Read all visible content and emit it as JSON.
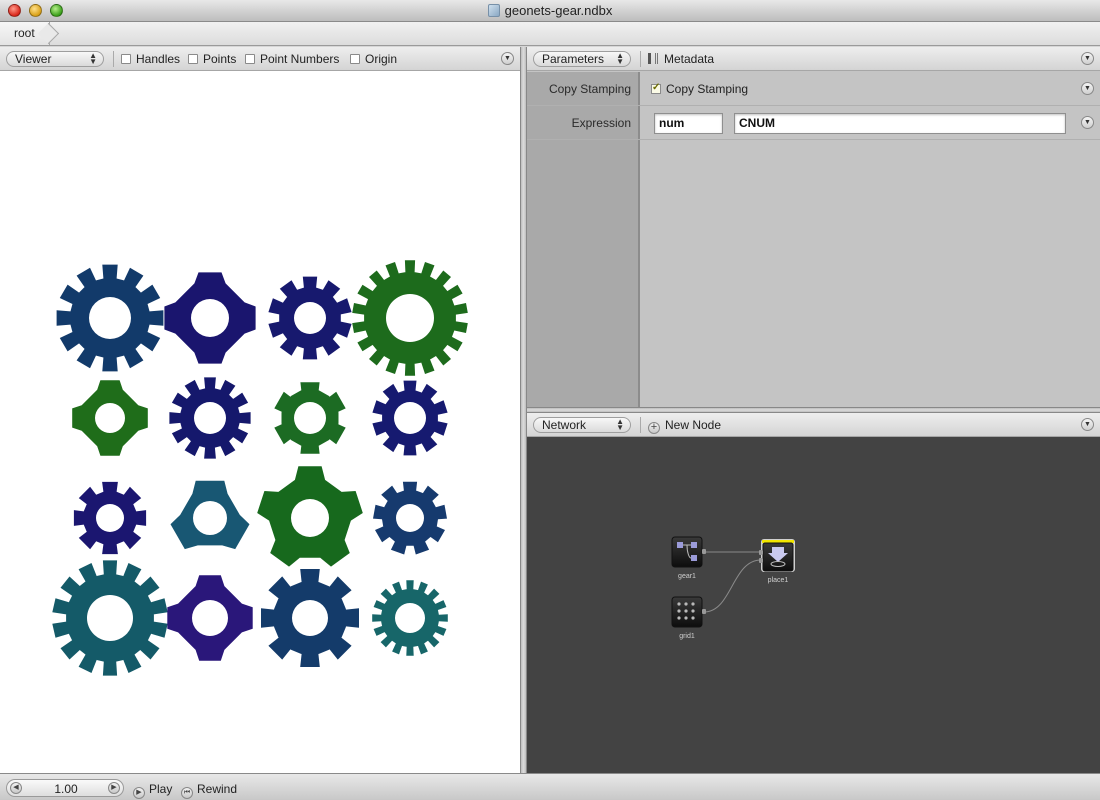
{
  "window": {
    "title": "geonets-gear.ndbx"
  },
  "path": {
    "root_label": "root"
  },
  "viewer": {
    "mode_label": "Viewer",
    "options": [
      {
        "label": "Handles"
      },
      {
        "label": "Points"
      },
      {
        "label": "Point Numbers"
      },
      {
        "label": "Origin"
      }
    ]
  },
  "parameters": {
    "tab_label": "Parameters",
    "metadata_label": "Metadata",
    "node_label": "Copy Stamping",
    "node_checkbox_label": "Copy Stamping",
    "expression_label": "Expression",
    "expression_name": "num",
    "expression_value": "CNUM"
  },
  "network": {
    "tab_label": "Network",
    "new_node_label": "New Node",
    "nodes": [
      {
        "name": "gear1"
      },
      {
        "name": "grid1"
      },
      {
        "name": "place1"
      }
    ]
  },
  "playback": {
    "frame": "1.00",
    "play_label": "Play",
    "rewind_label": "Rewind"
  },
  "gears": [
    {
      "teeth": 12,
      "color": "#123a6a"
    },
    {
      "teeth": 4,
      "color": "#1a156e"
    },
    {
      "teeth": 10,
      "color": "#17196e"
    },
    {
      "teeth": 18,
      "color": "#1d6b1c"
    },
    {
      "teeth": 4,
      "color": "#1f6d1a"
    },
    {
      "teeth": 12,
      "color": "#15186c"
    },
    {
      "teeth": 6,
      "color": "#1c6b23"
    },
    {
      "teeth": 10,
      "color": "#161a70"
    },
    {
      "teeth": 8,
      "color": "#1b1670"
    },
    {
      "teeth": 3,
      "color": "#185773"
    },
    {
      "teeth": 5,
      "color": "#17691d"
    },
    {
      "teeth": 9,
      "color": "#163a6e"
    },
    {
      "teeth": 14,
      "color": "#145a68"
    },
    {
      "teeth": 4,
      "color": "#2a177a"
    },
    {
      "teeth": 8,
      "color": "#143b6a"
    },
    {
      "teeth": 16,
      "color": "#176669"
    }
  ]
}
